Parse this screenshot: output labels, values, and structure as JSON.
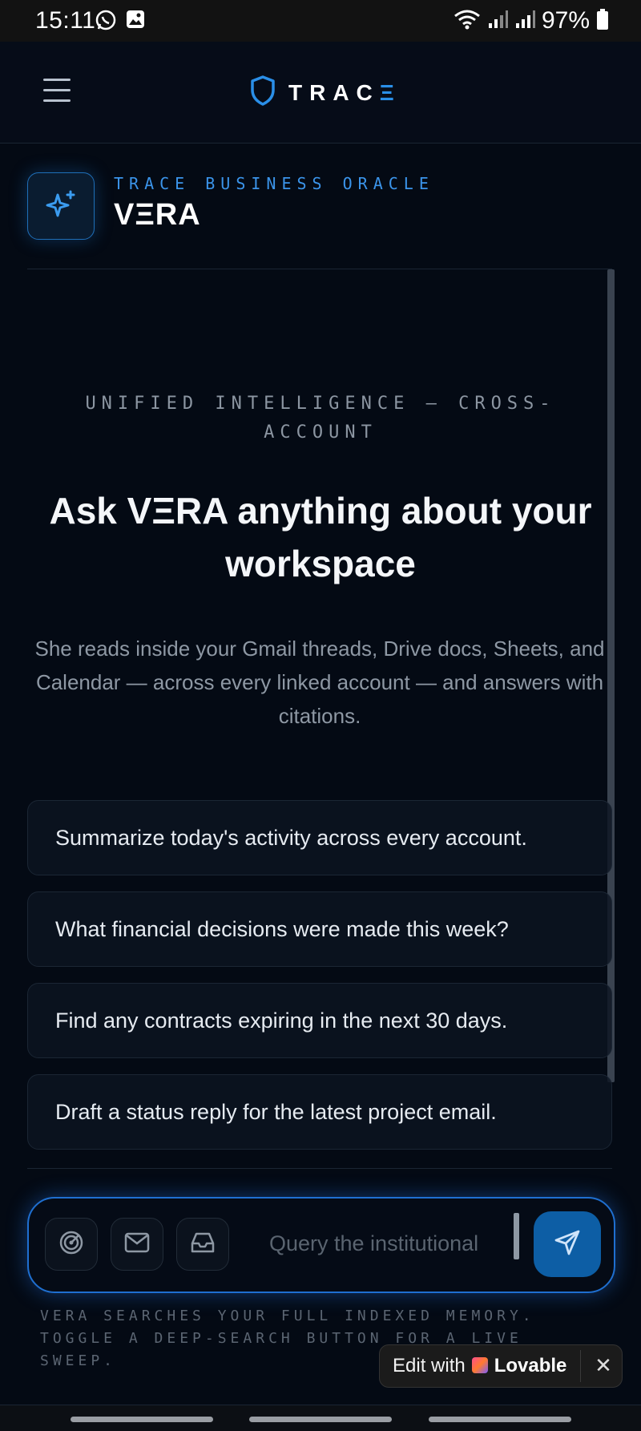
{
  "status_bar": {
    "time": "15:11",
    "battery": "97%",
    "left_icons": [
      "whatsapp-icon",
      "gallery-icon"
    ],
    "right_icons": [
      "wifi-icon",
      "signal-icon",
      "signal-icon",
      "battery-icon"
    ]
  },
  "header": {
    "brand_main": "TRAC",
    "brand_accent": "Ξ"
  },
  "oracle": {
    "kicker": "TRACE BUSINESS ORACLE",
    "name": "VΞRA"
  },
  "main": {
    "kicker": "UNIFIED INTELLIGENCE — CROSS-ACCOUNT",
    "headline": "Ask VΞRA anything about your workspace",
    "description": "She reads inside your Gmail threads, Drive docs, Sheets, and Calendar — across every linked account — and answers with citations.",
    "suggestions": [
      "Summarize today's activity across every account.",
      "What financial decisions were made this week?",
      "Find any contracts expiring in the next 30 days.",
      "Draft a status reply for the latest project email."
    ]
  },
  "composer": {
    "placeholder": "Query the institutional memory",
    "footnote": "VERA SEARCHES YOUR FULL INDEXED MEMORY. TOGGLE A DEEP-SEARCH BUTTON FOR A LIVE SWEEP."
  },
  "badge": {
    "text": "Edit with",
    "brand": "Lovable",
    "close": "✕"
  },
  "colors": {
    "accent": "#2a8fe8",
    "background": "#040a14",
    "send": "#0d5ea5"
  }
}
